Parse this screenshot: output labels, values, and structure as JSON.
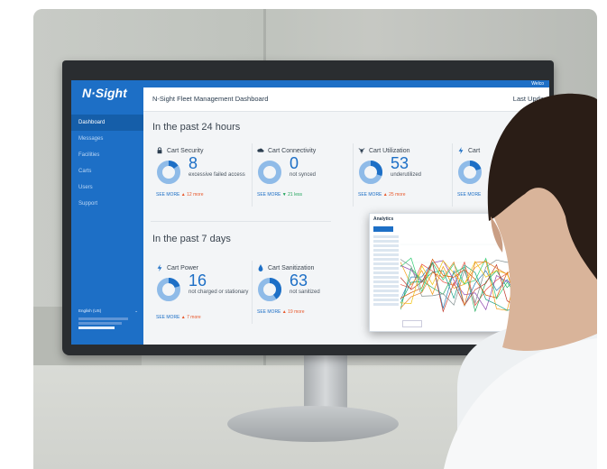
{
  "app": {
    "logo": "N·Sight",
    "title": "N-Sight Fleet Management Dashboard",
    "header_right": "Last Upda",
    "welcome": "Welco"
  },
  "sidebar": {
    "items": [
      {
        "label": "Dashboard",
        "active": true
      },
      {
        "label": "Messages"
      },
      {
        "label": "Facilities"
      },
      {
        "label": "Carts"
      },
      {
        "label": "Users"
      },
      {
        "label": "Support"
      }
    ],
    "language": "English (US)"
  },
  "sections": {
    "past_24": "In the past 24 hours",
    "past_7": "In the past 7 days"
  },
  "cards": [
    {
      "title": "Cart Security",
      "value": "8",
      "desc": "excessive failed access",
      "see_more": "SEE MORE",
      "trend": "▲ 12 more",
      "trend_dir": "up",
      "fill": 0.15
    },
    {
      "title": "Cart Connectivity",
      "value": "0",
      "desc": "not synced",
      "see_more": "SEE MORE",
      "trend": "▼ 21 less",
      "trend_dir": "down",
      "fill": 0.0
    },
    {
      "title": "Cart Utilization",
      "value": "53",
      "desc": "underutilized",
      "see_more": "SEE MORE",
      "trend": "▲ 25 more",
      "trend_dir": "up",
      "fill": 0.3
    },
    {
      "title": "Cart",
      "value": "",
      "desc": "",
      "see_more": "SEE MORE",
      "trend": "",
      "trend_dir": "up",
      "fill": 0.2
    },
    {
      "title": "Cart Power",
      "value": "16",
      "desc": "not charged or stationary",
      "see_more": "SEE MORE",
      "trend": "▲ 7 more",
      "trend_dir": "up",
      "fill": 0.2
    },
    {
      "title": "Cart Sanitization",
      "value": "63",
      "desc": "not sanitized",
      "see_more": "SEE MORE",
      "trend": "▲ 19 more",
      "trend_dir": "up",
      "fill": 0.4
    }
  ],
  "analytics": {
    "title": "Analytics"
  },
  "colors": {
    "brand": "#1d6fc6",
    "up": "#e8572a",
    "down": "#1fa35a"
  }
}
